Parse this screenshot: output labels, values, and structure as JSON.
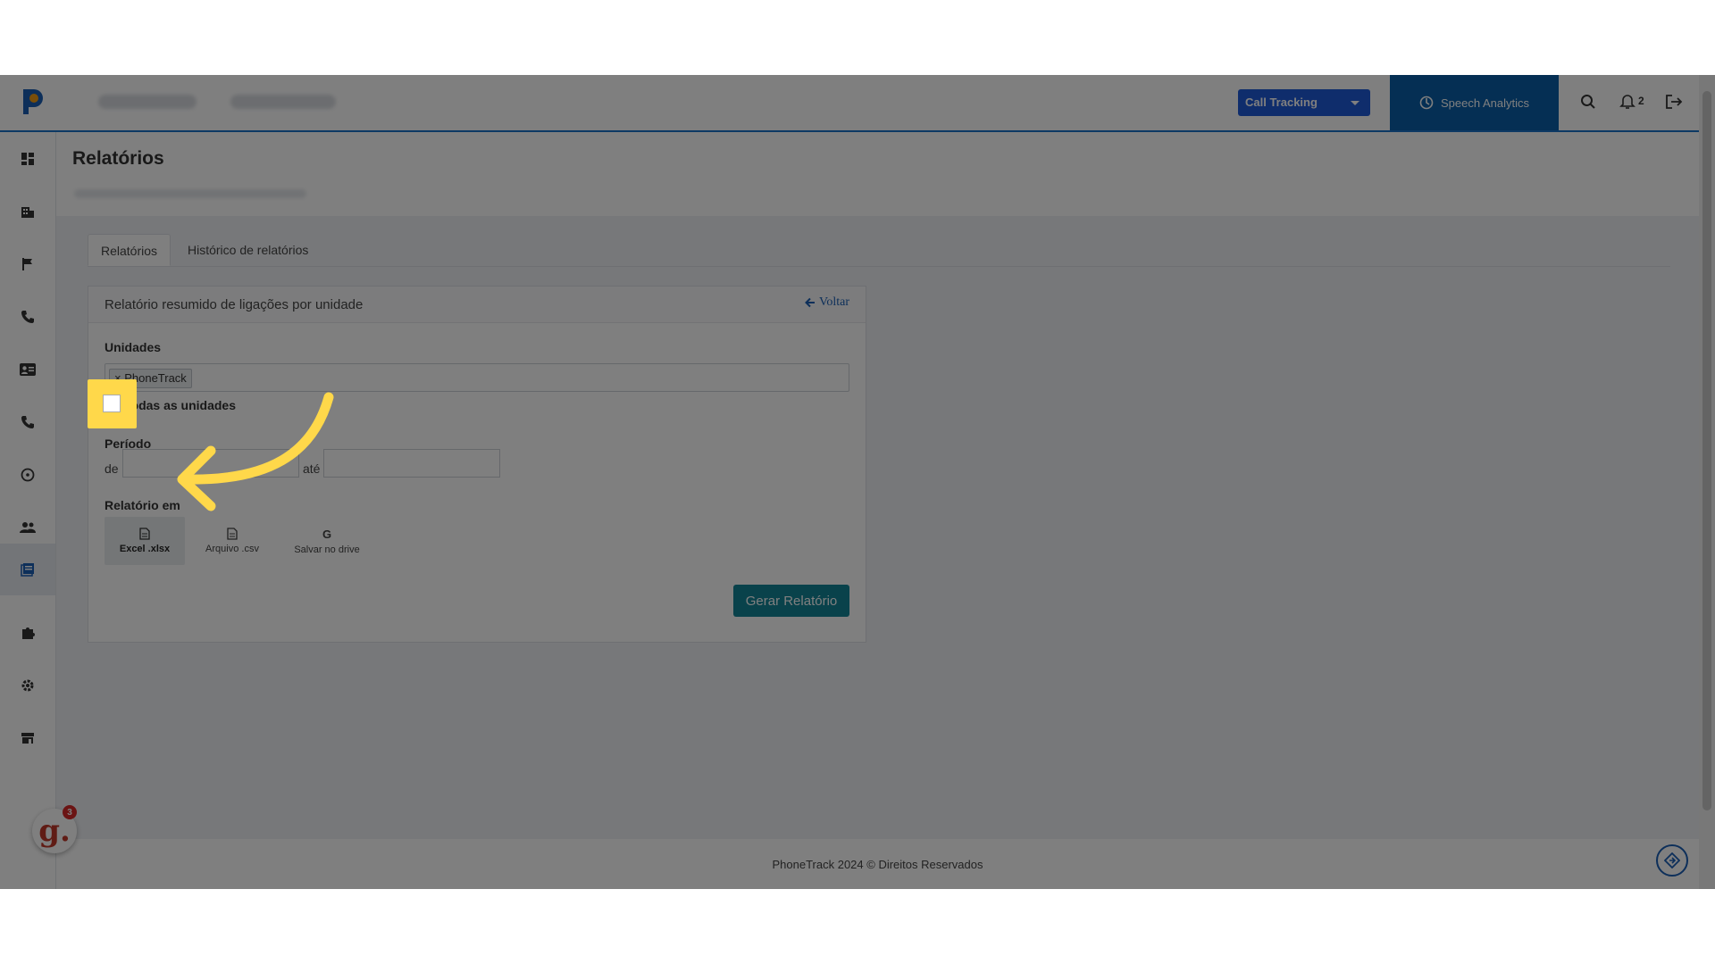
{
  "topbar": {
    "product_select": "Call Tracking",
    "speech_analytics": "Speech Analytics",
    "notification_count": "2"
  },
  "page": {
    "title": "Relatórios"
  },
  "tabs": [
    {
      "label": "Relatórios"
    },
    {
      "label": "Histórico de relatórios"
    }
  ],
  "card": {
    "title": "Relatório resumido de ligações por unidade",
    "back_label": "Voltar",
    "units_label": "Unidades",
    "selected_unit": "× PhoneTrack",
    "all_units_label": "Todas as unidades",
    "period_label": "Período",
    "from_label": "de",
    "to_label": "até",
    "report_in_label": "Relatório em",
    "formats": [
      {
        "label": "Excel .xlsx",
        "icon": "file-icon"
      },
      {
        "label": "Arquivo .csv",
        "icon": "file-icon"
      },
      {
        "label": "Salvar no drive",
        "icon": "google-icon"
      }
    ],
    "generate_button": "Gerar Relatório"
  },
  "footer": {
    "text": "PhoneTrack 2024 © Direitos Reservados"
  },
  "widget": {
    "badge_letter": "g.",
    "badge_count": "3"
  },
  "colors": {
    "accent_blue": "#1e5ad8",
    "speech_bg": "#0a5ea8",
    "generate_bg": "#138496",
    "highlight": "#ffd84a"
  }
}
